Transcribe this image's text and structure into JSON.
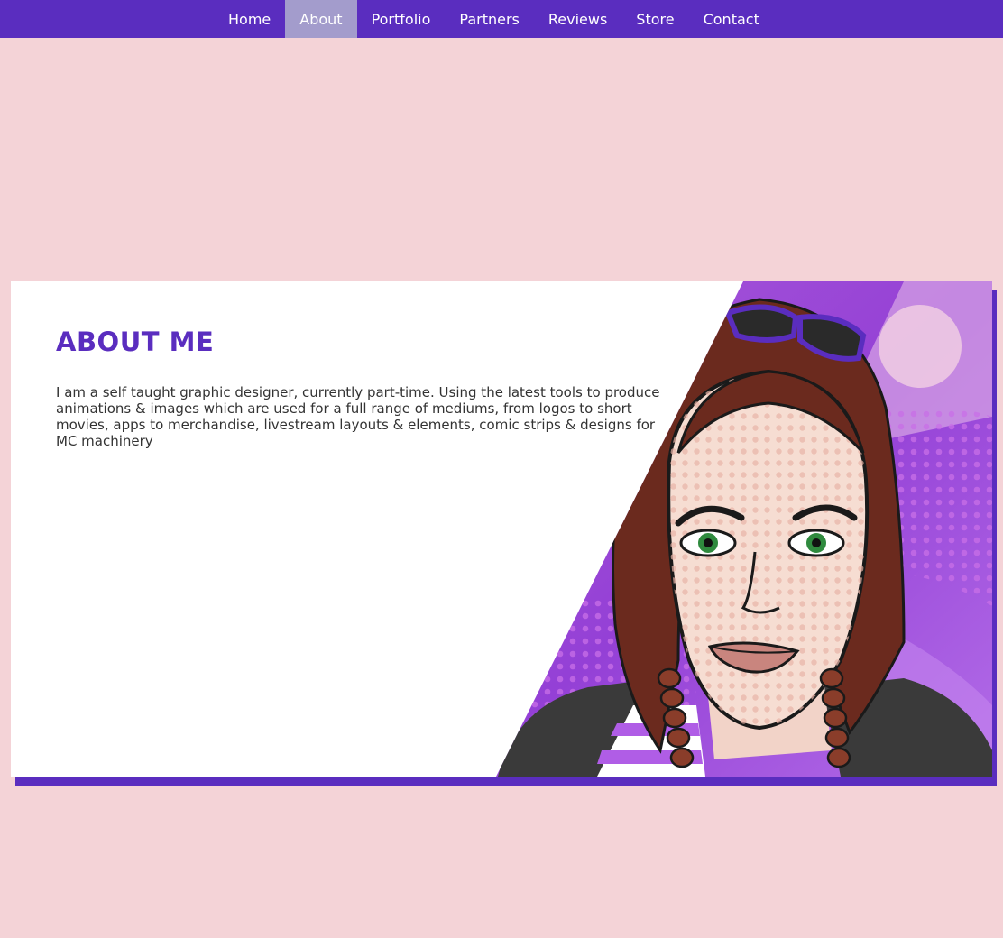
{
  "nav": {
    "items": [
      {
        "label": "Home",
        "active": false
      },
      {
        "label": "About",
        "active": true
      },
      {
        "label": "Portfolio",
        "active": false
      },
      {
        "label": "Partners",
        "active": false
      },
      {
        "label": "Reviews",
        "active": false
      },
      {
        "label": "Store",
        "active": false
      },
      {
        "label": "Contact",
        "active": false
      }
    ]
  },
  "about": {
    "title": "ABOUT ME",
    "text": "I am a self taught graphic designer, currently part-time. Using the latest tools to produce animations & images which are used for a full range of mediums, from logos to short movies, apps to merchandise, livestream layouts & elements, comic strips & designs for MC machinery",
    "image": "cartoon-portrait-illustration"
  },
  "colors": {
    "page_background": "#f4d3d7",
    "accent": "#5a2dbf",
    "nav_active": "#a39ccc",
    "card_background": "#ffffff"
  }
}
